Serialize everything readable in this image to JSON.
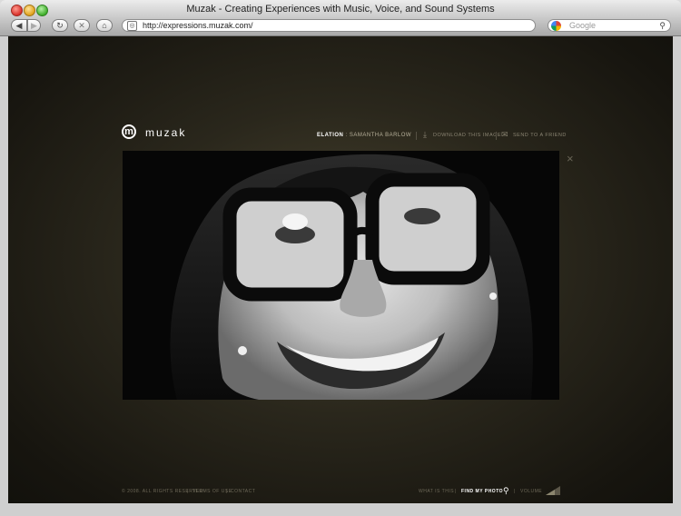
{
  "window": {
    "title": "Muzak - Creating Experiences with Music, Voice, and Sound Systems"
  },
  "toolbar": {
    "url": "http://expressions.muzak.com/",
    "search_placeholder": "Google"
  },
  "page": {
    "logo_text": "muzak",
    "logo_mark": "m",
    "caption_title": "ELATION",
    "caption_sep": ":",
    "caption_artist": "SAMANTHA BARLOW",
    "download_label": "DOWNLOAD THIS IMAGE",
    "send_label": "SEND TO A FRIEND",
    "close_glyph": "×"
  },
  "footer": {
    "copyright": "© 2008. ALL RIGHTS RESERVED",
    "terms": "TERMS OF USE",
    "contact": "CONTACT",
    "what_is_this": "WHAT IS THIS",
    "find_my_photo": "FIND MY PHOTO",
    "volume": "VOLUME"
  },
  "colors": {
    "bg": "#2a271c",
    "caption": "#ffffff",
    "muted": "#8a8472"
  }
}
